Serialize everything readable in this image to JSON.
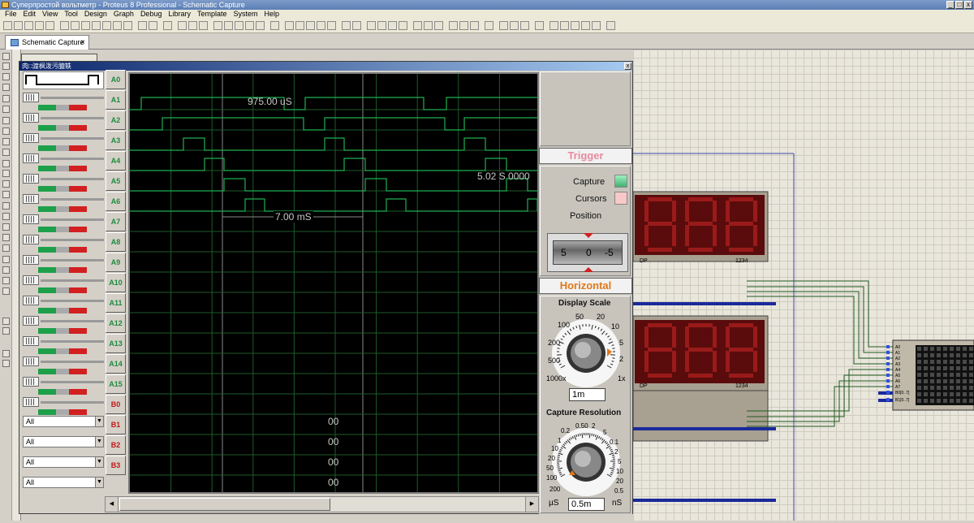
{
  "window": {
    "title": "Суперпростой вольтметр - Proteus 8 Professional - Schematic Capture"
  },
  "menu": [
    "File",
    "Edit",
    "View",
    "Tool",
    "Design",
    "Graph",
    "Debug",
    "Library",
    "Template",
    "System",
    "Help"
  ],
  "tab": {
    "label": "Schematic Capture"
  },
  "analyzer": {
    "title": "肉□渡枫泼污臆轶",
    "channels_a": [
      "A0",
      "A1",
      "A2",
      "A3",
      "A4",
      "A5",
      "A6",
      "A7",
      "A8",
      "A9",
      "A10",
      "A11",
      "A12",
      "A13",
      "A14",
      "A15"
    ],
    "channels_b": [
      "B0",
      "B1",
      "B2",
      "B3"
    ],
    "bus_selects": [
      "All",
      "All",
      "All",
      "All"
    ],
    "bus_values": [
      "00",
      "00",
      "00",
      "00"
    ],
    "readout_time": "975.00 uS",
    "readout_cursor": "5.02 S 0000",
    "readout_delta": "7.00 mS"
  },
  "trigger": {
    "header": "Trigger",
    "capture_label": "Capture",
    "cursors_label": "Cursors",
    "position_label": "Position",
    "position_left": "5",
    "position_mid": "0",
    "position_right": "-5"
  },
  "horizontal": {
    "header": "Horizontal",
    "display_scale_label": "Display Scale",
    "display_scale_value": "1m",
    "display_ticks": [
      "50",
      "20",
      "100",
      "10",
      "200",
      "5",
      "500",
      "2",
      "1000x",
      "1x"
    ],
    "capture_resolution_label": "Capture Resolution",
    "capture_resolution_value": "0.5m",
    "capture_ticks": [
      "0.50",
      "2",
      "0.2",
      "5",
      "1",
      "0.1",
      "10",
      "2",
      "20",
      "5",
      "50",
      "10",
      "100",
      "20",
      "200",
      "0.5"
    ],
    "unit_left": "µS",
    "unit_right": "nS"
  },
  "schematic": {
    "display_labels": [
      "DP",
      "1234",
      "DP",
      "1234"
    ],
    "chip_pins": [
      "A0",
      "A1",
      "A2",
      "A3",
      "A4",
      "A5",
      "A6",
      "A7",
      "B0[0..7]",
      "B1[0..7]"
    ]
  },
  "colors": {
    "trace": "#1fb050",
    "grid": "#1e5a2a",
    "trigger_text": "#e88aa0",
    "horizontal_text": "#e07818",
    "seg_red": "#9a1a1a"
  }
}
